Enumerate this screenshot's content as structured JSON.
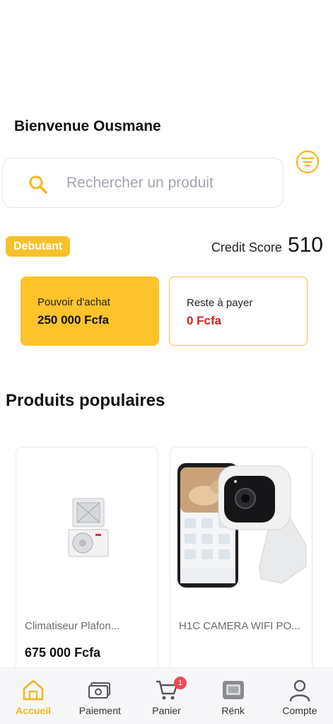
{
  "header": {
    "greeting": "Bienvenue Ousmane"
  },
  "search": {
    "placeholder": "Rechercher un produit",
    "value": ""
  },
  "status": {
    "level_badge": "Debutant",
    "credit_label": "Credit Score",
    "credit_value": "510"
  },
  "cards": {
    "purchase_power": {
      "title": "Pouvoir d'achat",
      "amount": "250 000 Fcfa"
    },
    "remaining": {
      "title": "Reste à payer",
      "amount": "0 Fcfa"
    }
  },
  "popular": {
    "title": "Produits populaires",
    "products": [
      {
        "name": "Climatiseur Plafon...",
        "price": "675 000 Fcfa"
      },
      {
        "name": "H1C CAMERA WIFI PO...",
        "price": ""
      }
    ]
  },
  "nav": {
    "items": [
      {
        "label": "Accueil",
        "icon": "home-icon",
        "active": true
      },
      {
        "label": "Paiement",
        "icon": "payment-icon",
        "active": false
      },
      {
        "label": "Panier",
        "icon": "cart-icon",
        "active": false,
        "badge": "1"
      },
      {
        "label": "Rënk",
        "icon": "rank-icon",
        "active": false
      },
      {
        "label": "Compte",
        "icon": "account-icon",
        "active": false
      }
    ]
  },
  "colors": {
    "accent": "#f8c12a",
    "danger": "#d61f1f",
    "badge": "#ef4b55"
  }
}
